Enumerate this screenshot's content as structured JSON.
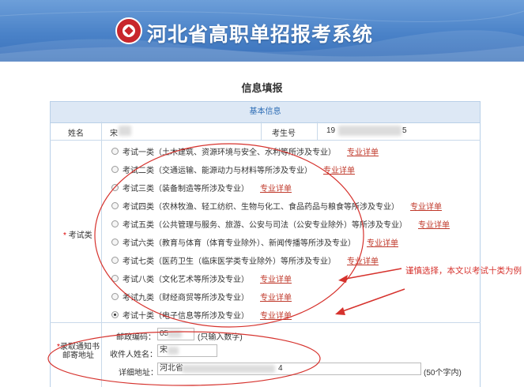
{
  "banner": {
    "title": "河北省高职单招报考系统"
  },
  "page_title": "信息填报",
  "section": {
    "heading": "基本信息"
  },
  "fields": {
    "name_label": "姓名",
    "name_value": "宋",
    "exam_no_label": "考生号",
    "exam_no_prefix": "19",
    "exam_no_suffix": "5"
  },
  "exam_category": {
    "required_mark": "*",
    "label": "考试类",
    "selected_index": 9,
    "options": [
      {
        "text": "考试一类（土木建筑、资源环境与安全、水利等所涉及专业）",
        "link": "专业详单"
      },
      {
        "text": "考试二类（交通运输、能源动力与材料等所涉及专业）",
        "link": "专业详单"
      },
      {
        "text": "考试三类（装备制造等所涉及专业）",
        "link": "专业详单"
      },
      {
        "text": "考试四类（农林牧渔、轻工纺织、生物与化工、食品药品与粮食等所涉及专业）",
        "link": "专业详单"
      },
      {
        "text": "考试五类（公共管理与服务、旅游、公安与司法（公安专业除外）等所涉及专业）",
        "link": "专业详单"
      },
      {
        "text": "考试六类（教育与体育（体育专业除外）、新闻传播等所涉及专业）",
        "link": "专业详单"
      },
      {
        "text": "考试七类（医药卫生（临床医学类专业除外）等所涉及专业）",
        "link": "专业详单"
      },
      {
        "text": "考试八类（文化艺术等所涉及专业）",
        "link": "专业详单"
      },
      {
        "text": "考试九类（财经商贸等所涉及专业）",
        "link": "专业详单"
      },
      {
        "text": "考试十类（电子信息等所涉及专业）",
        "link": "专业详单"
      }
    ]
  },
  "mailing": {
    "required_mark": "*",
    "label_line1": "录取通知书",
    "label_line2": "邮寄地址",
    "postcode_label": "邮政编码：",
    "postcode_value": "05",
    "postcode_hint": "(只输入数字)",
    "recipient_label": "收件人姓名：",
    "recipient_value": "宋",
    "address_label": "详细地址：",
    "address_prefix": "河北省",
    "address_suffix": "4",
    "address_hint": "(50个字内)"
  },
  "annotation": {
    "text": "谨慎选择，本文以考试十类为例"
  },
  "colors": {
    "banner": "#4a82c8",
    "section_header_bg": "#dde8f5",
    "section_header_text": "#2d6db5",
    "link": "#c0392b",
    "annotation": "#d6322d"
  }
}
